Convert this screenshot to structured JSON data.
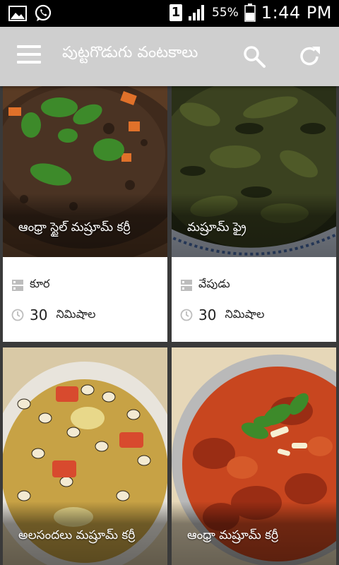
{
  "status_bar": {
    "battery_percent": "55%",
    "time": "1:44 PM",
    "sim_label": "1",
    "icons": [
      "image-icon",
      "whatsapp-icon",
      "sim-icon",
      "signal-icon",
      "battery-icon"
    ]
  },
  "app_bar": {
    "title": "పుట్టగొడుగు వంటకాలు",
    "icons": [
      "menu-icon",
      "search-icon",
      "refresh-icon"
    ]
  },
  "recipes": [
    {
      "title": "ఆంధ్రా స్టైల్ మష్రూమ్ కర్రీ",
      "category": "కూర",
      "time_value": "30",
      "time_unit": "నిమిషాల"
    },
    {
      "title": "మష్రూమ్ ఫ్రై",
      "category": "వేపుడు",
      "time_value": "30",
      "time_unit": "నిమిషాల"
    },
    {
      "title": "అలసందలు మష్రూమ్ కర్రీ"
    },
    {
      "title": "ఆంధ్రా మష్రూమ్ కర్రీ"
    }
  ],
  "colors": {
    "status_bar": "#000000",
    "app_bar": "#cfcfcf",
    "background": "#3a3a3a",
    "card": "#ffffff"
  }
}
